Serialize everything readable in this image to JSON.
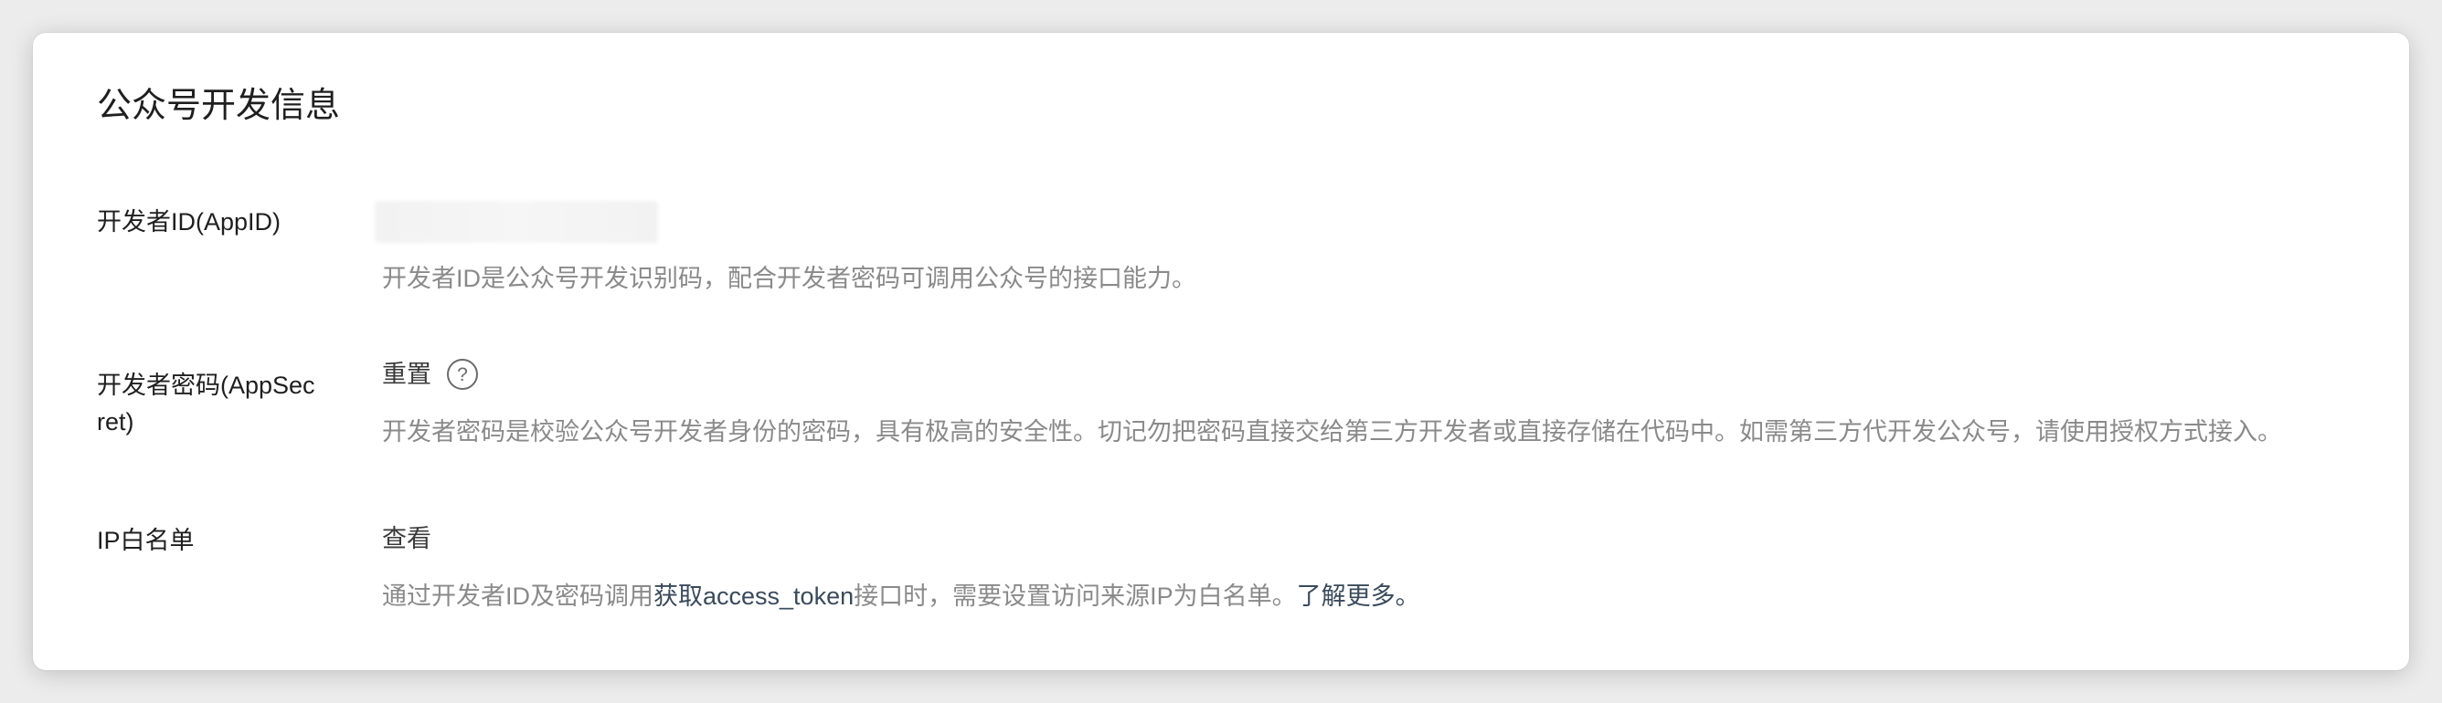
{
  "panel": {
    "title": "公众号开发信息"
  },
  "rows": {
    "appid": {
      "label": "开发者ID(AppID)",
      "description": "开发者ID是公众号开发识别码，配合开发者密码可调用公众号的接口能力。"
    },
    "appsecret": {
      "label_line1": "开发者密码(AppSec",
      "label_line2": "ret)",
      "action": "重置",
      "help_icon": "question-circle-icon",
      "description": "开发者密码是校验公众号开发者身份的密码，具有极高的安全性。切记勿把密码直接交给第三方开发者或直接存储在代码中。如需第三方代开发公众号，请使用授权方式接入。"
    },
    "ip_whitelist": {
      "label": "IP白名单",
      "action": "查看",
      "description_prefix": "通过开发者ID及密码调用",
      "description_link": "获取access_token",
      "description_middle": "接口时，需要设置访问来源IP为白名单。",
      "description_learn_more": "了解更多。"
    }
  },
  "colors": {
    "page_background": "#ececec",
    "card_background": "#ffffff",
    "label_text": "#1f1f1f",
    "description_text": "#8a8a8a",
    "link_text": "#3a4a5c"
  }
}
